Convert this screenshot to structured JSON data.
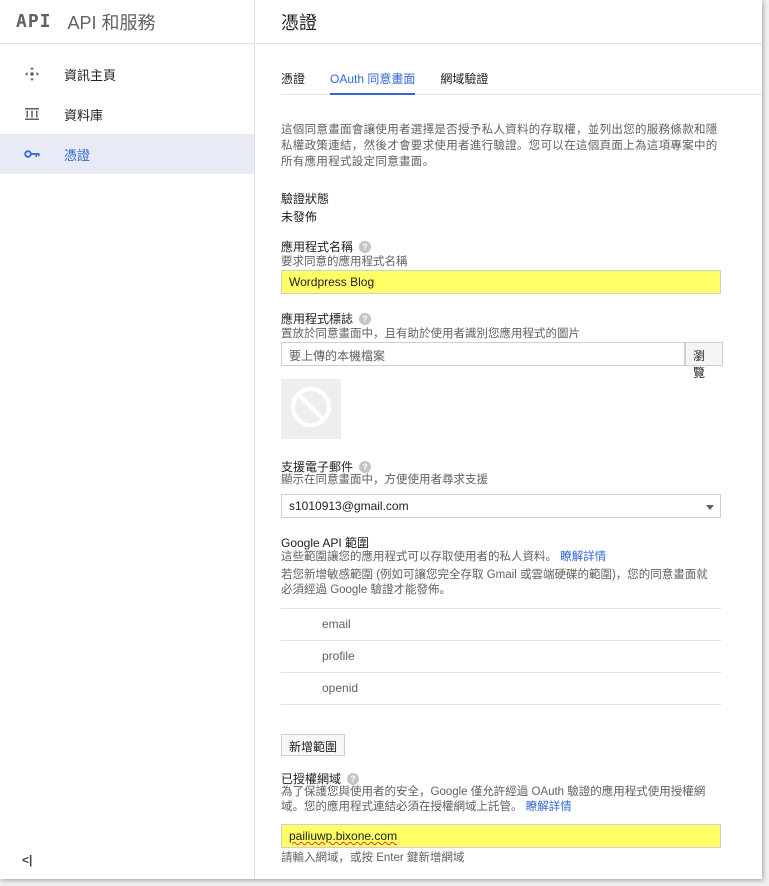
{
  "brand": {
    "logo": "API",
    "title": "API 和服務"
  },
  "sidebar": {
    "items": [
      {
        "label": "資訊主頁",
        "icon": "dashboard-icon",
        "active": false
      },
      {
        "label": "資料庫",
        "icon": "library-icon",
        "active": false
      },
      {
        "label": "憑證",
        "icon": "key-icon",
        "active": true
      }
    ],
    "collapse_label": "<|"
  },
  "page": {
    "title": "憑證"
  },
  "tabs": [
    {
      "label": "憑證",
      "active": false
    },
    {
      "label": "OAuth 同意畫面",
      "active": true
    },
    {
      "label": "網域驗證",
      "active": false
    }
  ],
  "consent": {
    "description": "這個同意畫面會讓使用者選擇是否授予私人資料的存取權，並列出您的服務條款和隱私權政策連結，然後才會要求使用者進行驗證。您可以在這個頁面上為這項專案中的所有應用程式設定同意畫面。",
    "verification_label": "驗證狀態",
    "verification_value": "未發佈",
    "app_name_label": "應用程式名稱",
    "app_name_hint": "要求同意的應用程式名稱",
    "app_name_value": "Wordpress Blog",
    "logo_label": "應用程式標誌",
    "logo_hint": "置放於同意畫面中，且有助於使用者識別您應用程式的圖片",
    "logo_placeholder": "要上傳的本機檔案",
    "browse_label": "瀏覽",
    "support_email_label": "支援電子郵件",
    "support_email_hint": "顯示在同意畫面中，方便使用者尋求支援",
    "support_email_value": "s1010913@gmail.com",
    "scopes_label": "Google API 範圍",
    "scopes_hint": "這些範圍讓您的應用程式可以存取使用者的私人資料。",
    "scopes_link": "瞭解詳情",
    "scopes_note": "若您新增敏感範圍 (例如可讓您完全存取 Gmail 或雲端硬碟的範圍)，您的同意畫面就必須經過 Google 驗證才能發佈。",
    "scopes": [
      "email",
      "profile",
      "openid"
    ],
    "add_scope_label": "新增範圍",
    "domains_label": "已授權網域",
    "domains_hint": "為了保護您與使用者的安全，Google 僅允許經過 OAuth 驗證的應用程式使用授權網域。您的應用程式連結必須在授權網域上託管。",
    "domains_link": "瞭解詳情",
    "domain_value": "pailiuwp.bixone.com",
    "domain_hint": "請輸入網域，或按 Enter 鍵新增網域"
  },
  "colors": {
    "accent": "#3367d6",
    "highlight": "#ffff66"
  }
}
